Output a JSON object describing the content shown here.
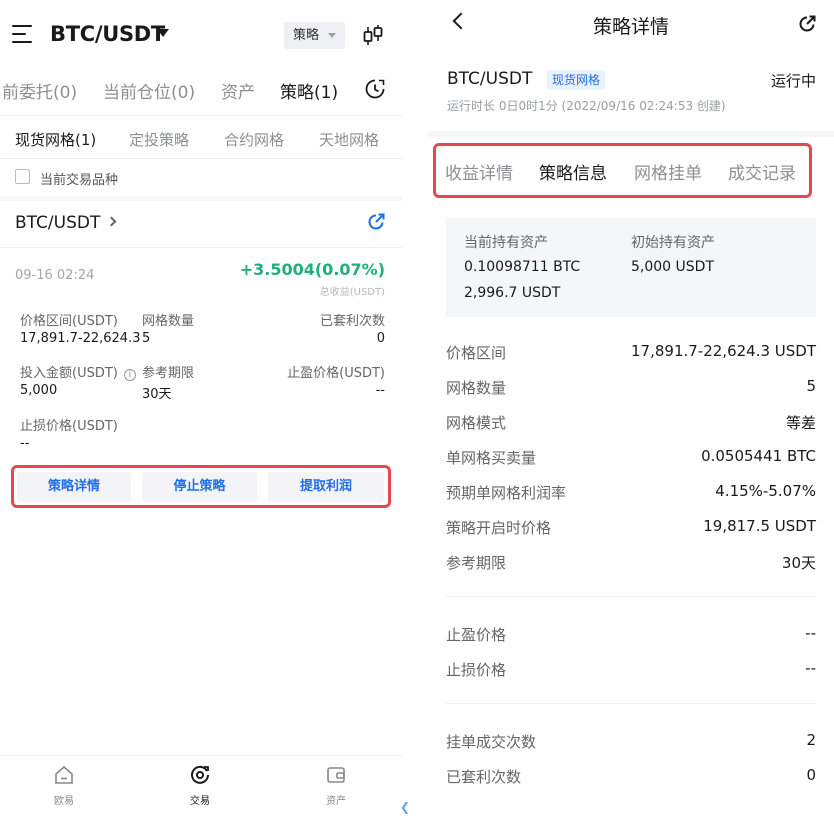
{
  "colors": {
    "accent": "#1f6fe5",
    "profit": "#1fb07a",
    "highlight": "#e5484d"
  },
  "left": {
    "header": {
      "pair": "BTC/USDT",
      "mode": "策略",
      "menu_icon": "menu-icon",
      "chart_icon": "candlestick-icon"
    },
    "main_tabs": [
      "前委托(0)",
      "当前仓位(0)",
      "资产",
      "策略(1)"
    ],
    "sub_tabs": [
      "现货网格(1)",
      "定投策略",
      "合约网格",
      "天地网格"
    ],
    "filter_label": "当前交易品种",
    "card": {
      "pair": "BTC/USDT",
      "date": "09-16 02:24",
      "pnl": "+3.5004(0.07%)",
      "pnl_label": "总收益(USDT)",
      "price_range_label": "价格区间(USDT)",
      "price_range": "17,891.7-22,624.3",
      "grid_count_label": "网格数量",
      "grid_count": "5",
      "arb_count_label": "已套利次数",
      "arb_count": "0",
      "invest_label": "投入金额(USDT)",
      "invest": "5,000",
      "period_label": "参考期限",
      "period": "30天",
      "take_profit_label": "止盈价格(USDT)",
      "take_profit": "--",
      "stop_loss_label": "止损价格(USDT)",
      "stop_loss": "--",
      "actions": [
        "策略详情",
        "停止策略",
        "提取利润"
      ]
    },
    "nav": [
      "欧易",
      "交易",
      "资产"
    ]
  },
  "right": {
    "title": "策略详情",
    "pair": "BTC/USDT",
    "badge": "现货网格",
    "status": "运行中",
    "runtime": "运行时长 0日0时1分 (2022/09/16 02:24:53 创建)",
    "tabs": [
      "收益详情",
      "策略信息",
      "网格挂单",
      "成交记录"
    ],
    "assets": {
      "current_label": "当前持有资产",
      "current_btc": "0.10098711 BTC",
      "current_usdt": "2,996.7 USDT",
      "initial_label": "初始持有资产",
      "initial_usdt": "5,000 USDT"
    },
    "rows": [
      {
        "label": "价格区间",
        "value": "17,891.7-22,624.3 USDT"
      },
      {
        "label": "网格数量",
        "value": "5"
      },
      {
        "label": "网格模式",
        "value": "等差"
      },
      {
        "label": "单网格买卖量",
        "value": "0.0505441 BTC"
      },
      {
        "label": "预期单网格利润率",
        "value": "4.15%-5.07%"
      },
      {
        "label": "策略开启时价格",
        "value": "19,817.5 USDT"
      },
      {
        "label": "参考期限",
        "value": "30天"
      }
    ],
    "rows2": [
      {
        "label": "止盈价格",
        "value": "--"
      },
      {
        "label": "止损价格",
        "value": "--"
      }
    ],
    "rows3": [
      {
        "label": "挂单成交次数",
        "value": "2"
      },
      {
        "label": "已套利次数",
        "value": "0"
      }
    ]
  }
}
